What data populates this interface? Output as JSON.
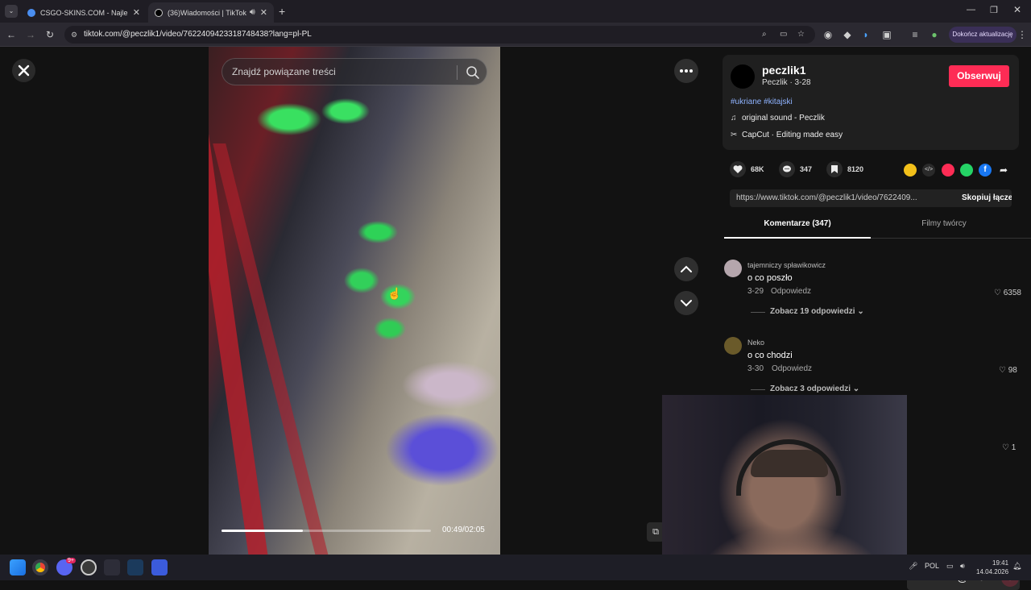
{
  "browser": {
    "tabs": [
      {
        "label": "CSGO-SKINS.COM - Najlepsze",
        "active": false
      },
      {
        "label": "(36)Wiadomości | TikTok",
        "active": true
      }
    ],
    "url": "tiktok.com/@peczlik1/video/7622409423318748438?lang=pl-PL",
    "update_button": "Dokończ aktualizację"
  },
  "video": {
    "search_placeholder": "Znajdź powiązane treści",
    "time": "00:49/02:05",
    "progress": 0.39
  },
  "creator": {
    "username": "peczlik1",
    "subline": "Peczlik · 3-28",
    "follow_label": "Obserwuj",
    "hashtags": "#ukriane #kitajski",
    "sound": "original sound - Peczlik",
    "capcut": "CapCut · Editing made easy"
  },
  "stats": {
    "likes": "68K",
    "comments": "347",
    "saves": "8120"
  },
  "share": {
    "link": "https://www.tiktok.com/@peczlik1/video/7622409...",
    "copy_label": "Skopiuj łącze"
  },
  "tabs": {
    "comments": "Komentarze (347)",
    "creator_videos": "Filmy twórcy"
  },
  "comments": [
    {
      "user": "tajemniczy spławikowicz",
      "text": "o co poszło",
      "date": "3-29",
      "reply": "Odpowiedz",
      "likes": "6358",
      "more": "Zobacz 19 odpowiedzi"
    },
    {
      "user": "Neko",
      "text": "o co chodzi",
      "date": "3-30",
      "reply": "Odpowiedz",
      "likes": "98",
      "more": "Zobacz 3 odpowiedzi"
    }
  ],
  "hidden_like": "1",
  "taskbar": {
    "lang": "POL",
    "time": "19:41",
    "date": "14.04.2026",
    "discord_badge": "9+"
  }
}
